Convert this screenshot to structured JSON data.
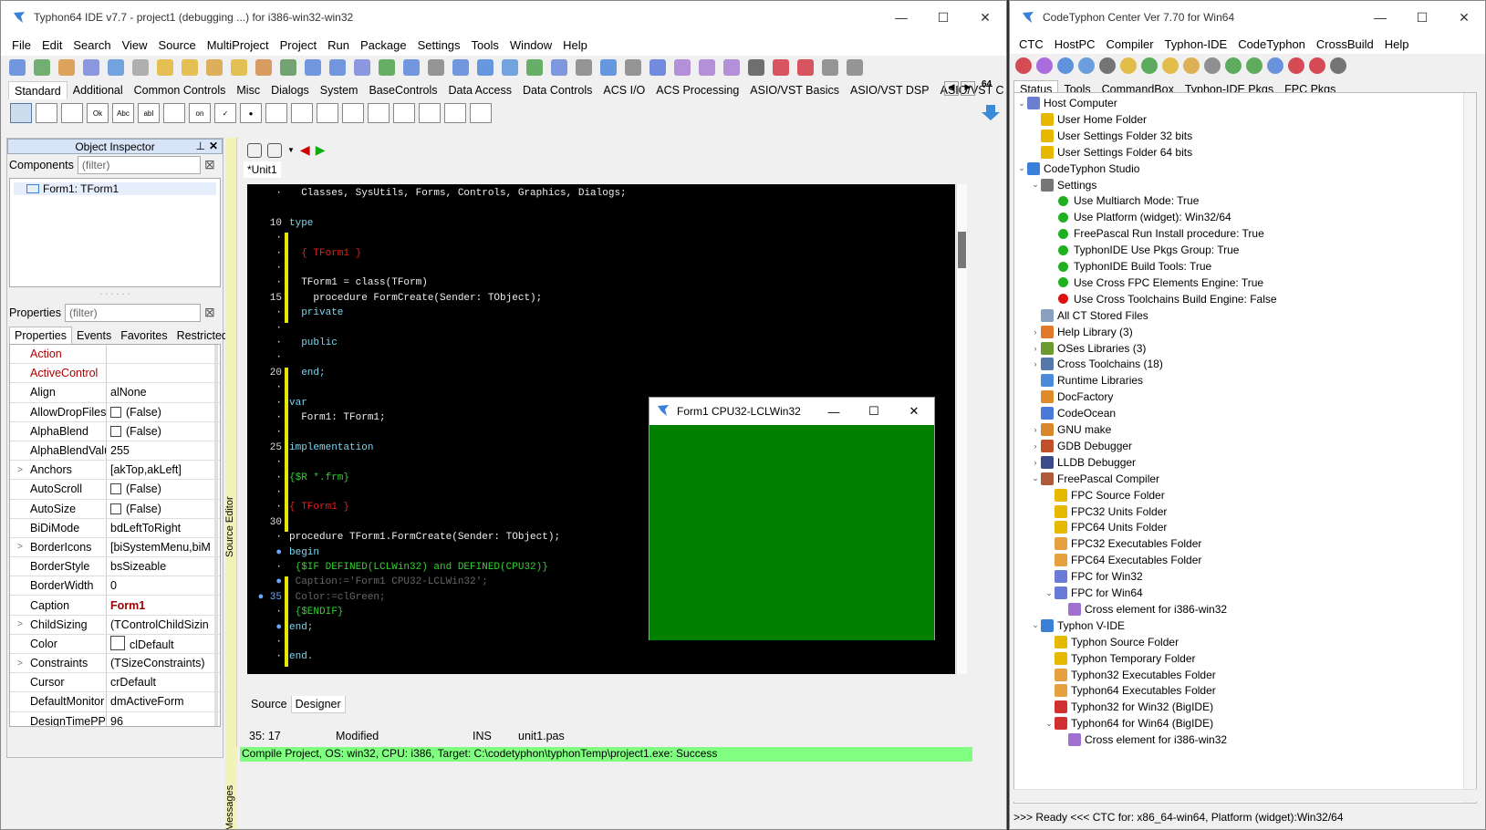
{
  "ide": {
    "title": "Typhon64 IDE v7.7 - project1 (debugging ...) for i386-win32-win32",
    "menu": [
      "File",
      "Edit",
      "Search",
      "View",
      "Source",
      "MultiProject",
      "Project",
      "Run",
      "Package",
      "Settings",
      "Tools",
      "Window",
      "Help"
    ],
    "palette_tabs": [
      "Standard",
      "Additional",
      "Common Controls",
      "Misc",
      "Dialogs",
      "System",
      "BaseControls",
      "Data Access",
      "Data Controls",
      "ACS I/O",
      "ACS Processing",
      "ASIO/VST Basics",
      "ASIO/VST DSP",
      "ASIO/VST C"
    ],
    "palette_icons": [
      "arrow",
      "TMainMenu",
      "TPopupMenu",
      "Ok",
      "Abc",
      "abI",
      "TMemo",
      "on",
      "✓",
      "●",
      "TListBox",
      "TComboBox",
      "TScrollBar",
      "TGroupBox",
      "TRadioGroup",
      "TCheckGroup",
      "TPanel",
      "TFrame",
      "TActionList"
    ],
    "arch_label": "64",
    "object_inspector": {
      "title": "Object Inspector",
      "components_label": "Components",
      "filter_placeholder": "(filter)",
      "tree_item": "Form1: TForm1",
      "properties_label": "Properties",
      "tabs": [
        "Properties",
        "Events",
        "Favorites",
        "Restricted"
      ],
      "rows": [
        {
          "name": "Action",
          "value": "",
          "red": true
        },
        {
          "name": "ActiveControl",
          "value": "",
          "red": true
        },
        {
          "name": "Align",
          "value": "alNone"
        },
        {
          "name": "AllowDropFiles",
          "value": "(False)",
          "check": true
        },
        {
          "name": "AlphaBlend",
          "value": "(False)",
          "check": true
        },
        {
          "name": "AlphaBlendValu",
          "value": "255"
        },
        {
          "name": "Anchors",
          "value": "[akTop,akLeft]",
          "expand": true
        },
        {
          "name": "AutoScroll",
          "value": "(False)",
          "check": true
        },
        {
          "name": "AutoSize",
          "value": "(False)",
          "check": true
        },
        {
          "name": "BiDiMode",
          "value": "bdLeftToRight"
        },
        {
          "name": "BorderIcons",
          "value": "[biSystemMenu,biM",
          "expand": true
        },
        {
          "name": "BorderStyle",
          "value": "bsSizeable"
        },
        {
          "name": "BorderWidth",
          "value": "0"
        },
        {
          "name": "Caption",
          "value": "Form1",
          "bold": true
        },
        {
          "name": "ChildSizing",
          "value": "(TControlChildSizin",
          "expand": true
        },
        {
          "name": "Color",
          "value": "clDefault",
          "swatch": true
        },
        {
          "name": "Constraints",
          "value": "(TSizeConstraints)",
          "expand": true
        },
        {
          "name": "Cursor",
          "value": "crDefault"
        },
        {
          "name": "DefaultMonitor",
          "value": "dmActiveForm"
        },
        {
          "name": "DesignTimePPI",
          "value": "96"
        }
      ]
    },
    "source_editor_label": "Source Editor",
    "editor_tab": "*Unit1",
    "code_lines": [
      {
        "n": "·",
        "t": "  Classes, SysUtils, Forms, Controls, Graphics, Dialogs;",
        "c": ""
      },
      {
        "n": "",
        "t": "",
        "c": ""
      },
      {
        "n": "10",
        "t": "type",
        "c": "kw"
      },
      {
        "n": "·",
        "t": "",
        "c": ""
      },
      {
        "n": "·",
        "t": "  { TForm1 }",
        "c": "cm"
      },
      {
        "n": "·",
        "t": "",
        "c": ""
      },
      {
        "n": "·",
        "t": "  TForm1 = class(TForm)",
        "c": ""
      },
      {
        "n": "15",
        "t": "    procedure FormCreate(Sender: TObject);",
        "c": ""
      },
      {
        "n": "·",
        "t": "  private",
        "c": "kw"
      },
      {
        "n": "·",
        "t": "",
        "c": ""
      },
      {
        "n": "·",
        "t": "  public",
        "c": "kw"
      },
      {
        "n": "·",
        "t": "",
        "c": ""
      },
      {
        "n": "20",
        "t": "  end;",
        "c": "kw"
      },
      {
        "n": "·",
        "t": "",
        "c": ""
      },
      {
        "n": "·",
        "t": "var",
        "c": "kw"
      },
      {
        "n": "·",
        "t": "  Form1: TForm1;",
        "c": ""
      },
      {
        "n": "·",
        "t": "",
        "c": ""
      },
      {
        "n": "25",
        "t": "implementation",
        "c": "kw"
      },
      {
        "n": "·",
        "t": "",
        "c": ""
      },
      {
        "n": "·",
        "t": "{$R *.frm}",
        "c": "dr"
      },
      {
        "n": "·",
        "t": "",
        "c": ""
      },
      {
        "n": "·",
        "t": "{ TForm1 }",
        "c": "cm"
      },
      {
        "n": "30",
        "t": "",
        "c": ""
      },
      {
        "n": "·",
        "t": "procedure TForm1.FormCreate(Sender: TObject);",
        "c": ""
      },
      {
        "n": "●",
        "t": "begin",
        "c": "kw"
      },
      {
        "n": "·",
        "t": " {$IF DEFINED(LCLWin32) and DEFINED(CPU32)}",
        "c": "dr"
      },
      {
        "n": "●",
        "t": " Caption:='Form1 CPU32-LCLWin32';",
        "c": "dim"
      },
      {
        "n": "● 35",
        "t": " Color:=clGreen;",
        "c": "dim"
      },
      {
        "n": "·",
        "t": " {$ENDIF}",
        "c": "dr"
      },
      {
        "n": "●",
        "t": "end;",
        "c": "kw"
      },
      {
        "n": "·",
        "t": "",
        "c": ""
      },
      {
        "n": "·",
        "t": "end.",
        "c": "kw"
      }
    ],
    "editor_bottom_tabs": [
      "Source",
      "Designer"
    ],
    "status": {
      "pos": "35: 17",
      "modified": "Modified",
      "mode": "INS",
      "file": "unit1.pas"
    },
    "messages_label": "Messages",
    "message": "Compile Project, OS: win32, CPU: i386, Target: C:\\codetyphon\\typhonTemp\\project1.exe: Success",
    "form1": {
      "title": "Form1 CPU32-LCLWin32",
      "color": "#008000"
    }
  },
  "ctc": {
    "title": "CodeTyphon Center Ver 7.70 for Win64",
    "menu": [
      "CTC",
      "HostPC",
      "Compiler",
      "Typhon-IDE",
      "CodeTyphon",
      "CrossBuild",
      "Help"
    ],
    "tabs": [
      "Status",
      "Tools",
      "CommandBox",
      "Typhon-IDE Pkgs",
      "FPC Pkgs"
    ],
    "tree": [
      {
        "lvl": 0,
        "ex": "v",
        "ic": "#6a7fd0",
        "t": "Host Computer"
      },
      {
        "lvl": 1,
        "ex": "",
        "ic": "#e6b800",
        "t": "User Home Folder"
      },
      {
        "lvl": 1,
        "ex": "",
        "ic": "#e6b800",
        "t": "User Settings Folder 32 bits"
      },
      {
        "lvl": 1,
        "ex": "",
        "ic": "#e6b800",
        "t": "User Settings Folder 64 bits"
      },
      {
        "lvl": 0,
        "ex": "v",
        "ic": "#3a7fd8",
        "t": "CodeTyphon Studio"
      },
      {
        "lvl": 1,
        "ex": "v",
        "ic": "#777",
        "t": "Settings"
      },
      {
        "lvl": 2,
        "ex": "",
        "dot": "#1fb01f",
        "t": "Use Multiarch Mode: True"
      },
      {
        "lvl": 2,
        "ex": "",
        "dot": "#1fb01f",
        "t": "Use Platform (widget): Win32/64"
      },
      {
        "lvl": 2,
        "ex": "",
        "dot": "#1fb01f",
        "t": "FreePascal Run Install procedure: True"
      },
      {
        "lvl": 2,
        "ex": "",
        "dot": "#1fb01f",
        "t": "TyphonIDE Use Pkgs Group: True"
      },
      {
        "lvl": 2,
        "ex": "",
        "dot": "#1fb01f",
        "t": "TyphonIDE Build Tools: True"
      },
      {
        "lvl": 2,
        "ex": "",
        "dot": "#1fb01f",
        "t": "Use Cross FPC Elements Engine: True"
      },
      {
        "lvl": 2,
        "ex": "",
        "dot": "#e01010",
        "t": "Use Cross Toolchains Build Engine: False"
      },
      {
        "lvl": 1,
        "ex": "",
        "ic": "#8aa0c0",
        "t": "All CT Stored Files"
      },
      {
        "lvl": 1,
        "ex": ">",
        "ic": "#e07a2a",
        "t": "Help Library (3)"
      },
      {
        "lvl": 1,
        "ex": ">",
        "ic": "#6a9a30",
        "t": "OSes Libraries (3)"
      },
      {
        "lvl": 1,
        "ex": ">",
        "ic": "#5577aa",
        "t": "Cross Toolchains (18)"
      },
      {
        "lvl": 1,
        "ex": "",
        "ic": "#4a8ad8",
        "t": "Runtime Libraries"
      },
      {
        "lvl": 1,
        "ex": "",
        "ic": "#e08a2a",
        "t": "DocFactory"
      },
      {
        "lvl": 1,
        "ex": "",
        "ic": "#4a7ad8",
        "t": "CodeOcean"
      },
      {
        "lvl": 1,
        "ex": ">",
        "ic": "#d8882a",
        "t": "GNU make"
      },
      {
        "lvl": 1,
        "ex": ">",
        "ic": "#c0502a",
        "t": "GDB Debugger"
      },
      {
        "lvl": 1,
        "ex": ">",
        "ic": "#3a4a8a",
        "t": "LLDB Debugger"
      },
      {
        "lvl": 1,
        "ex": "v",
        "ic": "#b0583a",
        "t": "FreePascal Compiler"
      },
      {
        "lvl": 2,
        "ex": "",
        "ic": "#e6b800",
        "t": "FPC Source Folder"
      },
      {
        "lvl": 2,
        "ex": "",
        "ic": "#e6b800",
        "t": "FPC32 Units Folder"
      },
      {
        "lvl": 2,
        "ex": "",
        "ic": "#e6b800",
        "t": "FPC64 Units Folder"
      },
      {
        "lvl": 2,
        "ex": "",
        "ic": "#e6a040",
        "t": "FPC32 Executables Folder"
      },
      {
        "lvl": 2,
        "ex": "",
        "ic": "#e6a040",
        "t": "FPC64 Executables Folder"
      },
      {
        "lvl": 2,
        "ex": "",
        "ic": "#6a7ad8",
        "t": "FPC for Win32"
      },
      {
        "lvl": 2,
        "ex": "v",
        "ic": "#6a7ad8",
        "t": "FPC for Win64"
      },
      {
        "lvl": 3,
        "ex": "",
        "ic": "#a070d0",
        "t": "Cross element for i386-win32"
      },
      {
        "lvl": 1,
        "ex": "v",
        "ic": "#3a7fd8",
        "t": "Typhon V-IDE"
      },
      {
        "lvl": 2,
        "ex": "",
        "ic": "#e6b800",
        "t": "Typhon Source Folder"
      },
      {
        "lvl": 2,
        "ex": "",
        "ic": "#e6b800",
        "t": "Typhon Temporary Folder"
      },
      {
        "lvl": 2,
        "ex": "",
        "ic": "#e6a040",
        "t": "Typhon32 Executables Folder"
      },
      {
        "lvl": 2,
        "ex": "",
        "ic": "#e6a040",
        "t": "Typhon64 Executables Folder"
      },
      {
        "lvl": 2,
        "ex": "",
        "ic": "#d03030",
        "t": "Typhon32 for Win32 (BigIDE)"
      },
      {
        "lvl": 2,
        "ex": "v",
        "ic": "#d03030",
        "t": "Typhon64 for Win64 (BigIDE)"
      },
      {
        "lvl": 3,
        "ex": "",
        "ic": "#a070d0",
        "t": "Cross element for i386-win32"
      }
    ],
    "status": ">>> Ready <<<  CTC for: x86_64-win64, Platform (widget):Win32/64"
  }
}
